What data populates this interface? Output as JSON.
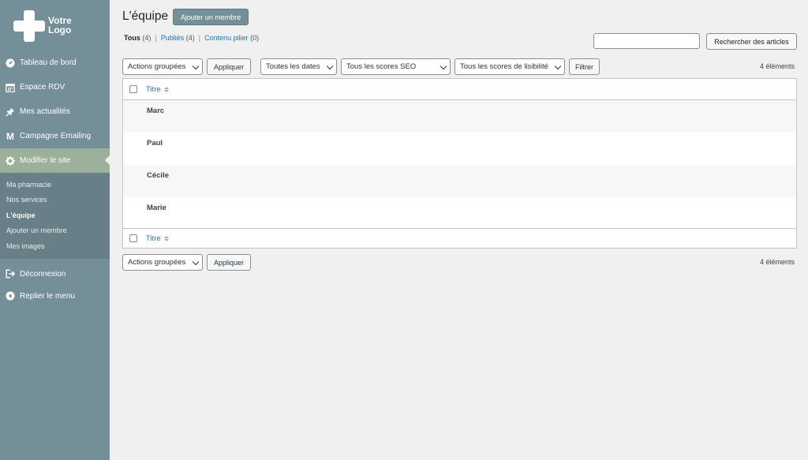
{
  "sidebar": {
    "logo_text": "Votre Logo",
    "menu": [
      {
        "label": "Tableau de bord",
        "icon": "dashboard-icon"
      },
      {
        "label": "Espace RDV",
        "icon": "calendar-icon"
      },
      {
        "label": "Mes actualités",
        "icon": "pin-icon"
      },
      {
        "label": "Campagne Emailing",
        "icon": "mailchimp-icon"
      },
      {
        "label": "Modifier le site",
        "icon": "gear-icon"
      }
    ],
    "submenu": [
      {
        "label": "Ma pharmacie"
      },
      {
        "label": "Nos services"
      },
      {
        "label": "L'équipe"
      },
      {
        "label": "Ajouter un membre"
      },
      {
        "label": "Mes images"
      }
    ],
    "bottom": [
      {
        "label": "Déconnexion",
        "icon": "logout-icon"
      },
      {
        "label": "Replier le menu",
        "icon": "collapse-icon"
      }
    ]
  },
  "header": {
    "title": "L'équipe",
    "add_button": "Ajouter un membre"
  },
  "filters": {
    "all_label": "Tous",
    "all_count": "(4)",
    "published_label": "Publiés",
    "published_count": "(4)",
    "pillar_label": "Contenu pilier",
    "pillar_count": "(0)",
    "separator": "|"
  },
  "search": {
    "placeholder": "",
    "button": "Rechercher des articles"
  },
  "toolbar": {
    "bulk_actions": "Actions groupées",
    "apply": "Appliquer",
    "dates": "Toutes les dates",
    "seo": "Tous les scores SEO",
    "readability": "Tous les scores de lisibilité",
    "filter": "Filtrer",
    "items_count": "4 éléments"
  },
  "table": {
    "column_title": "Titre",
    "rows": [
      "Marc",
      "Paul",
      "Cécile",
      "Marie"
    ]
  },
  "colors": {
    "sidebar": "#758f98",
    "active_menu": "#9cb09a",
    "link": "#2271b1"
  }
}
